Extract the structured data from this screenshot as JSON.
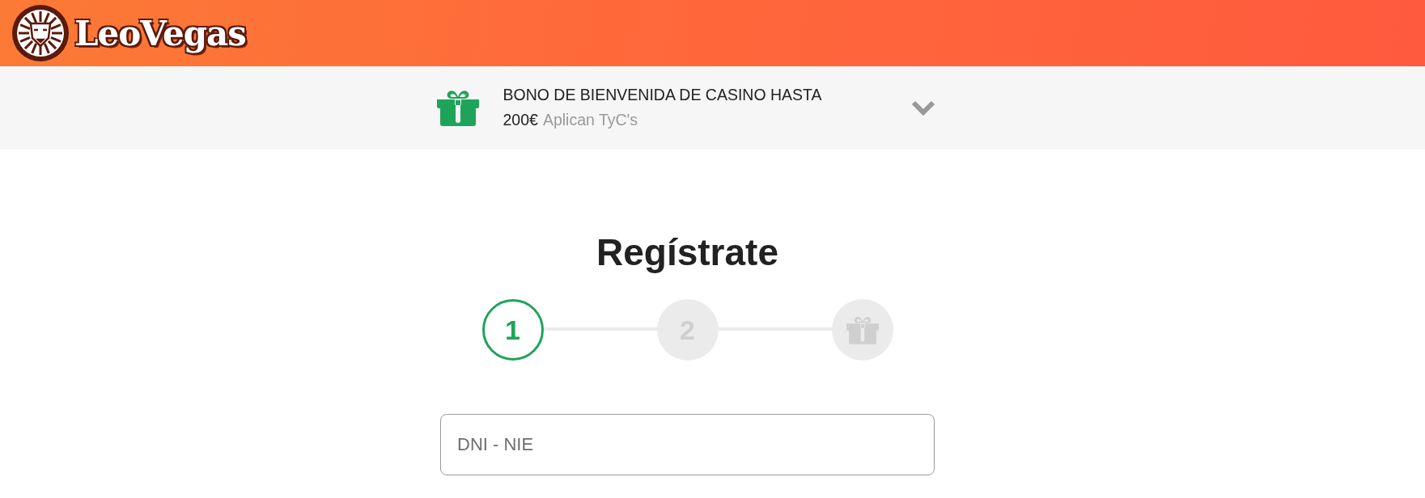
{
  "header": {
    "logo": "LeoVegas"
  },
  "promo": {
    "offer": "BONO DE BIENVENIDA DE CASINO HASTA",
    "amount": "200€",
    "terms": "Aplican TyC's",
    "expanded": false
  },
  "title": "Regístrate",
  "steps": [
    {
      "kind": "number",
      "label": "1",
      "active": true
    },
    {
      "kind": "number",
      "label": "2",
      "active": false
    },
    {
      "kind": "gift",
      "active": false
    }
  ],
  "field": {
    "placeholder": "DNI - NIE"
  }
}
